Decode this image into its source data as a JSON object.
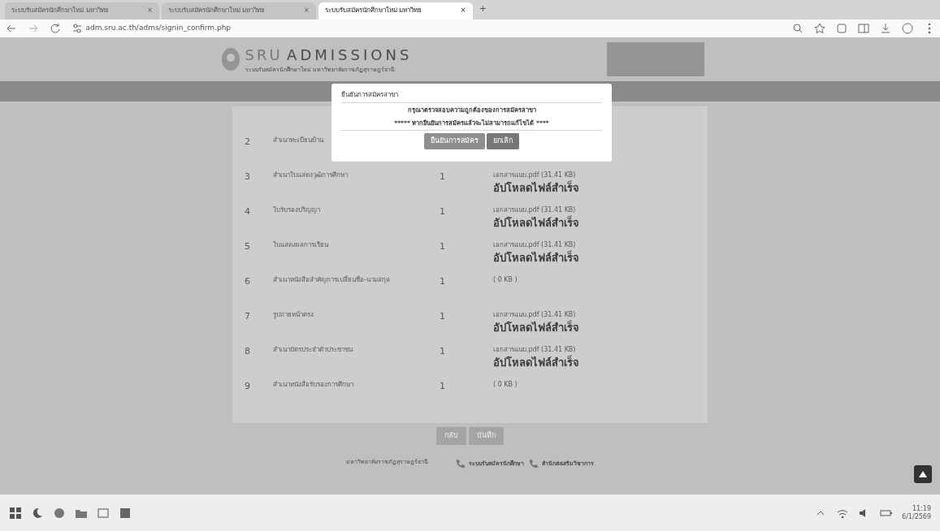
{
  "browser": {
    "tabs": [
      {
        "title": "ระบบรับสมัครนักศึกษาใหม่ มหาวิทย",
        "close": "×",
        "selected": false
      },
      {
        "title": "ระบบรับสมัครนักศึกษาใหม่ มหาวิทย",
        "close": "×",
        "selected": false
      },
      {
        "title": "ระบบรับสมัครนักศึกษาใหม่ มหาวิทย",
        "close": "×",
        "selected": true
      }
    ],
    "new_tab": "+",
    "url": "adm.sru.ac.th/adms/signin_confirm.php"
  },
  "header": {
    "logo_text": "SRU",
    "title": "ADMISSIONS",
    "subtitle": "ระบบรับสมัครนักศึกษาใหม่ มหาวิทยาลัยราชภัฏสุราษฎร์ธานี"
  },
  "documents": [
    {
      "no": "2",
      "name": "สำเนาทะเบียนบ้าน"
    },
    {
      "no": "3",
      "name": "สำเนาใบแสดงวุฒิการศึกษา",
      "count": "1",
      "file": "เอกสารแนบ.pdf (31.41 KB)",
      "status": "อัปโหลดไฟล์สำเร็จ"
    },
    {
      "no": "4",
      "name": "ใบรับรองปริญญา",
      "count": "1",
      "file": "เอกสารแนบ.pdf (31.41 KB)",
      "status": "อัปโหลดไฟล์สำเร็จ"
    },
    {
      "no": "5",
      "name": "ใบแสดงผลการเรียน",
      "count": "1",
      "file": "เอกสารแนบ.pdf (31.41 KB)",
      "status": "อัปโหลดไฟล์สำเร็จ"
    },
    {
      "no": "6",
      "name": "สำเนาหนังสือสำคัญการเปลี่ยนชื่อ-นามสกุล",
      "count": "1",
      "file": "( 0 KB )"
    },
    {
      "no": "7",
      "name": "รูปถ่ายหน้าตรง",
      "count": "1",
      "file": "เอกสารแนบ.pdf (31.41 KB)",
      "status": "อัปโหลดไฟล์สำเร็จ"
    },
    {
      "no": "8",
      "name": "สำเนาบัตรประจำตัวประชาชน",
      "count": "1",
      "file": "เอกสารแนบ.pdf (31.41 KB)",
      "status": "อัปโหลดไฟล์สำเร็จ"
    },
    {
      "no": "9",
      "name": "สำเนาหนังสือรับรองการศึกษา",
      "count": "1",
      "file": "( 0 KB )"
    }
  ],
  "form_buttons": [
    "กลับ",
    "บันทึก"
  ],
  "footer": {
    "address": "มหาวิทยาลัยราชภัฏสุราษฎร์ธานี",
    "contacts": [
      {
        "title": "ระบบรับสมัครนักศึกษา"
      },
      {
        "title": "สำนักส่งเสริมวิชาการ"
      }
    ]
  },
  "modal": {
    "title": "ยืนยันการสมัครสาขา",
    "message": "กรุณาตรวจสอบความถูกต้องของการสมัครสาขา",
    "warning": "***** หากยืนยันการสมัครแล้วจะไม่สามารถแก้ไขได้ ****",
    "buttons": [
      {
        "label": "ยืนยันการสมัคร",
        "kind": "confirm"
      },
      {
        "label": "ยกเลิก",
        "kind": "cancel"
      }
    ]
  },
  "taskbar": {
    "time": "11:19",
    "date": "6/1/2569"
  }
}
